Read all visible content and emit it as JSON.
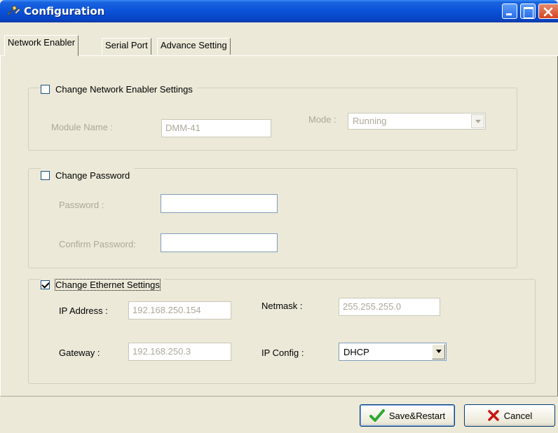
{
  "window": {
    "title": "Configuration",
    "title_icon": "tools-icon"
  },
  "tabs": [
    {
      "label": "Network Enabler",
      "active": true
    },
    {
      "label": "Serial Port",
      "active": false
    },
    {
      "label": "Advance Setting",
      "active": false
    }
  ],
  "network_enabler_group": {
    "checkbox_label": "Change Network Enabler Settings",
    "checked": false,
    "module_name_label": "Module Name :",
    "module_name_value": "DMM-41",
    "mode_label": "Mode :",
    "mode_value": "Running"
  },
  "password_group": {
    "checkbox_label": "Change Password",
    "checked": false,
    "password_label": "Password :",
    "password_value": "",
    "confirm_label": "Confirm Password:",
    "confirm_value": ""
  },
  "ethernet_group": {
    "checkbox_label": "Change Ethernet Settings",
    "checked": true,
    "ip_label": "IP Address :",
    "ip_value": "192.168.250.154",
    "netmask_label": "Netmask :",
    "netmask_value": "255.255.255.0",
    "gateway_label": "Gateway :",
    "gateway_value": "192.168.250.3",
    "ipconfig_label": "IP Config :",
    "ipconfig_value": "DHCP"
  },
  "buttons": {
    "save_restart": "Save&Restart",
    "cancel": "Cancel"
  },
  "colors": {
    "titlebar": "#0a52d8",
    "window_bg": "#ece9d8",
    "save_check": "#2fa82f",
    "cancel_x": "#c81414"
  }
}
